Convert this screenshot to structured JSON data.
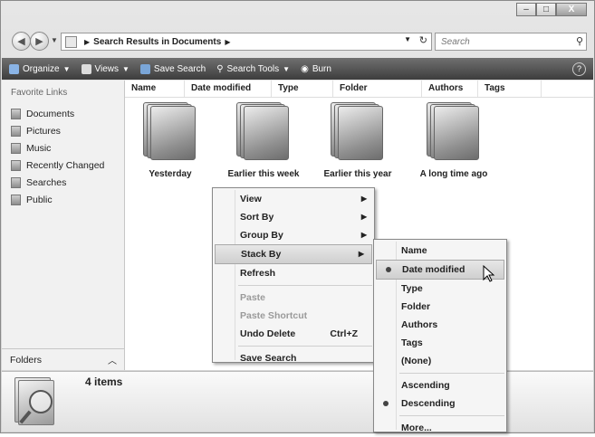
{
  "window": {
    "caption_buttons": [
      {
        "name": "minimize-button",
        "glyph": "–"
      },
      {
        "name": "maximize-button",
        "glyph": "□"
      },
      {
        "name": "close-button",
        "glyph": "X"
      }
    ]
  },
  "address": {
    "breadcrumb": "Search Results in Documents",
    "search_placeholder": "Search"
  },
  "toolbar": {
    "organize": "Organize",
    "views": "Views",
    "save_search": "Save Search",
    "search_tools": "Search Tools",
    "burn": "Burn",
    "help": "?"
  },
  "navpane": {
    "header": "Favorite Links",
    "items": [
      "Documents",
      "Pictures",
      "Music",
      "Recently Changed",
      "Searches",
      "Public"
    ],
    "folders": "Folders"
  },
  "columns": [
    "Name",
    "Date modified",
    "Type",
    "Folder",
    "Authors",
    "Tags"
  ],
  "stacks": [
    "Yesterday",
    "Earlier this week",
    "Earlier this year",
    "A long time ago"
  ],
  "details": {
    "count": "4 items"
  },
  "context_menu": {
    "view": "View",
    "sort_by": "Sort By",
    "group_by": "Group By",
    "stack_by": "Stack By",
    "refresh": "Refresh",
    "paste": "Paste",
    "paste_shortcut": "Paste Shortcut",
    "undo_delete": "Undo Delete",
    "undo_accel": "Ctrl+Z",
    "save_search": "Save Search"
  },
  "submenu": {
    "name": "Name",
    "date_modified": "Date modified",
    "type": "Type",
    "folder": "Folder",
    "authors": "Authors",
    "tags": "Tags",
    "none": "(None)",
    "ascending": "Ascending",
    "descending": "Descending",
    "more": "More..."
  }
}
